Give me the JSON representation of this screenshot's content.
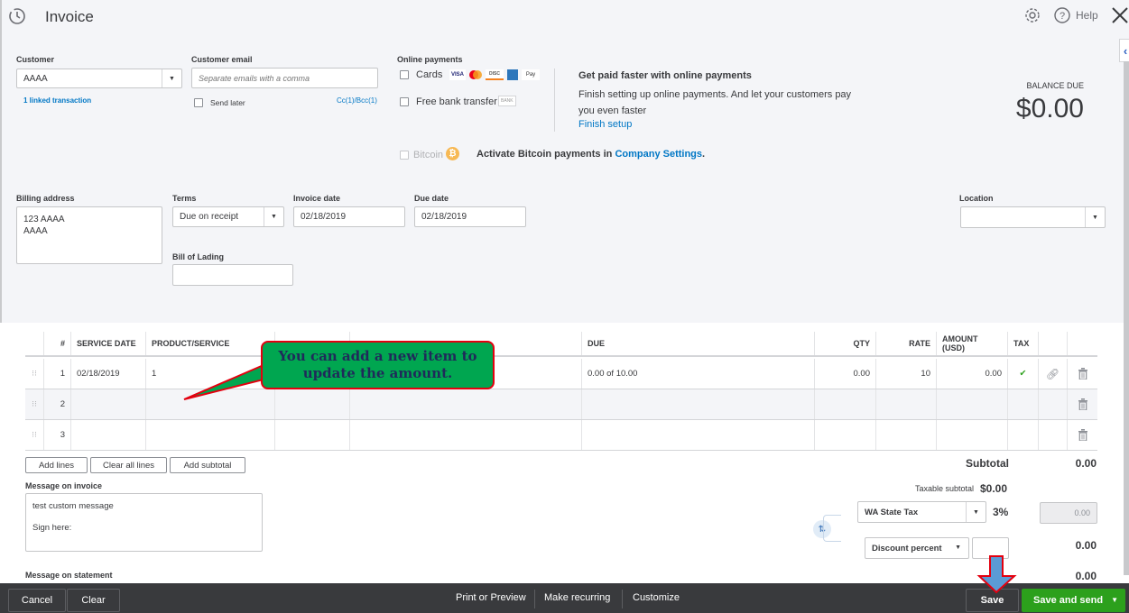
{
  "header": {
    "title": "Invoice",
    "help_label": "Help"
  },
  "customer": {
    "label": "Customer",
    "value": "AAAA",
    "linked_transaction": "1 linked transaction"
  },
  "customer_email": {
    "label": "Customer email",
    "placeholder": "Separate emails with a comma",
    "send_later_label": "Send later",
    "send_later_checked": false,
    "cc_bcc": "Cc(1)/Bcc(1)"
  },
  "online_payments": {
    "label": "Online payments",
    "cards_label": "Cards",
    "cards_checked": false,
    "card_logos": [
      "VISA",
      "Mastercard",
      "Discover",
      "Amex",
      "Apple Pay"
    ],
    "bank_label": "Free bank transfer",
    "bank_badge": "BANK",
    "bank_checked": false,
    "promo_title": "Get paid faster with online payments",
    "promo_text": "Finish setting up online payments. And let your customers pay you even faster",
    "promo_link": "Finish setup",
    "bitcoin_label": "Bitcoin",
    "bitcoin_text": "Activate Bitcoin payments in ",
    "bitcoin_link": "Company Settings",
    "bitcoin_suffix": "."
  },
  "balance": {
    "label": "BALANCE DUE",
    "amount": "$0.00"
  },
  "billing": {
    "label": "Billing address",
    "line1": "123 AAAA",
    "line2": "AAAA"
  },
  "terms": {
    "label": "Terms",
    "value": "Due on receipt"
  },
  "invoice_date": {
    "label": "Invoice date",
    "value": "02/18/2019"
  },
  "due_date": {
    "label": "Due date",
    "value": "02/18/2019"
  },
  "bill_of_lading": {
    "label": "Bill of Lading",
    "value": ""
  },
  "location": {
    "label": "Location",
    "value": ""
  },
  "table": {
    "headers": {
      "num": "#",
      "service_date": "SERVICE DATE",
      "product": "PRODUCT/SERVICE",
      "due": "DUE",
      "qty": "QTY",
      "rate": "RATE",
      "amount": "AMOUNT (USD)",
      "tax": "TAX"
    },
    "rows": [
      {
        "num": "1",
        "service_date": "02/18/2019",
        "product": "1",
        "due": "0.00 of 10.00",
        "qty": "0.00",
        "rate": "10",
        "amount": "0.00",
        "tax": "✔"
      },
      {
        "num": "2",
        "service_date": "",
        "product": "",
        "due": "",
        "qty": "",
        "rate": "",
        "amount": "",
        "tax": ""
      },
      {
        "num": "3",
        "service_date": "",
        "product": "",
        "due": "",
        "qty": "",
        "rate": "",
        "amount": "",
        "tax": ""
      }
    ]
  },
  "line_buttons": {
    "add_lines": "Add lines",
    "clear_all_lines": "Clear all lines",
    "add_subtotal": "Add subtotal"
  },
  "message_invoice": {
    "label": "Message on invoice",
    "line1": "test custom message",
    "line2": "Sign here:"
  },
  "message_statement": {
    "label": "Message on statement"
  },
  "totals": {
    "subtotal_label": "Subtotal",
    "subtotal_value": "0.00",
    "taxable_label": "Taxable subtotal",
    "taxable_value": "$0.00",
    "tax_rate_select": "WA State Tax",
    "tax_rate_percent": "3%",
    "tax_amount": "0.00",
    "discount_select": "Discount percent",
    "discount_value": "",
    "discount_amount": "0.00",
    "total_value": "0.00"
  },
  "callout": {
    "text_line1": "You can add a new item to",
    "text_line2": "update the amount."
  },
  "footer": {
    "cancel": "Cancel",
    "clear": "Clear",
    "print_preview": "Print or Preview",
    "make_recurring": "Make recurring",
    "customize": "Customize",
    "save": "Save",
    "save_and_send": "Save and send"
  },
  "colors": {
    "link": "#0077c5",
    "primary_button": "#2ca01c",
    "footer_bg": "#393a3d",
    "callout_bg": "#00a650",
    "callout_border": "#e3000f",
    "annotation_arrow": "#5b9bd5"
  }
}
